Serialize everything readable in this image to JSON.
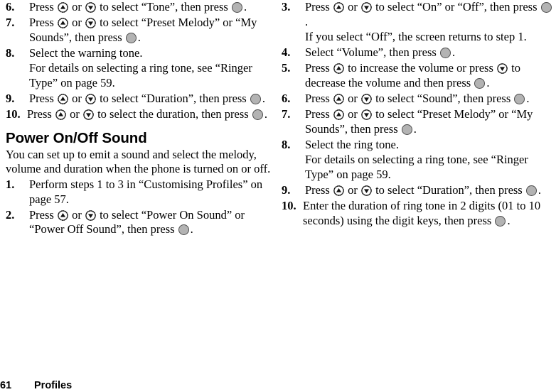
{
  "document": {
    "footer": {
      "page_number": "61",
      "section_title": "Profiles"
    }
  },
  "icons": {
    "up_key": "nav-up-key-icon",
    "down_key": "nav-down-key-icon",
    "select_key": "center-select-key-icon"
  },
  "colors": {
    "text": "#000000",
    "page_background": "#ffffff",
    "select_key_fill": "#b3b3b3",
    "select_key_stroke": "#4d4d4d"
  },
  "left_column": {
    "steps_continued": [
      {
        "number": "6.",
        "parts": [
          {
            "t": "text",
            "v": "Press "
          },
          {
            "t": "key",
            "v": "up"
          },
          {
            "t": "text",
            "v": " or "
          },
          {
            "t": "key",
            "v": "down"
          },
          {
            "t": "text",
            "v": " to select “Tone”, then press "
          },
          {
            "t": "key",
            "v": "select"
          },
          {
            "t": "text",
            "v": "."
          }
        ]
      },
      {
        "number": "7.",
        "parts": [
          {
            "t": "text",
            "v": "Press "
          },
          {
            "t": "key",
            "v": "up"
          },
          {
            "t": "text",
            "v": " or "
          },
          {
            "t": "key",
            "v": "down"
          },
          {
            "t": "text",
            "v": " to select “Preset Melody” or “My Sounds”, then press "
          },
          {
            "t": "key",
            "v": "select"
          },
          {
            "t": "text",
            "v": "."
          }
        ]
      },
      {
        "number": "8.",
        "parts": [
          {
            "t": "text",
            "v": "Select the warning tone."
          }
        ],
        "continuation": [
          {
            "t": "text",
            "v": "For details on selecting a ring tone, see “Ringer Type” on page 59."
          }
        ]
      },
      {
        "number": "9.",
        "parts": [
          {
            "t": "text",
            "v": "Press "
          },
          {
            "t": "key",
            "v": "up"
          },
          {
            "t": "text",
            "v": " or "
          },
          {
            "t": "key",
            "v": "down"
          },
          {
            "t": "text",
            "v": " to select “Duration”, then press "
          },
          {
            "t": "key",
            "v": "select"
          },
          {
            "t": "text",
            "v": "."
          }
        ]
      },
      {
        "number": "10.",
        "wide": true,
        "parts": [
          {
            "t": "text",
            "v": "Press "
          },
          {
            "t": "key",
            "v": "up"
          },
          {
            "t": "text",
            "v": " or "
          },
          {
            "t": "key",
            "v": "down"
          },
          {
            "t": "text",
            "v": " to select the duration, then press "
          },
          {
            "t": "key",
            "v": "select"
          },
          {
            "t": "text",
            "v": "."
          }
        ]
      }
    ],
    "section": {
      "heading": "Power On/Off Sound",
      "intro": "You can set up to emit a sound and select the melody, volume and duration when the phone is turned on or off.",
      "steps": [
        {
          "number": "1.",
          "parts": [
            {
              "t": "text",
              "v": "Perform steps 1 to 3 in “Customising Profiles” on page 57."
            }
          ]
        },
        {
          "number": "2.",
          "parts": [
            {
              "t": "text",
              "v": "Press "
            },
            {
              "t": "key",
              "v": "up"
            },
            {
              "t": "text",
              "v": " or "
            },
            {
              "t": "key",
              "v": "down"
            },
            {
              "t": "text",
              "v": " to select “Power On Sound” or “Power Off Sound”, then press "
            },
            {
              "t": "key",
              "v": "select"
            },
            {
              "t": "text",
              "v": "."
            }
          ]
        }
      ]
    }
  },
  "right_column": {
    "steps": [
      {
        "number": "3.",
        "parts": [
          {
            "t": "text",
            "v": "Press "
          },
          {
            "t": "key",
            "v": "up"
          },
          {
            "t": "text",
            "v": " or "
          },
          {
            "t": "key",
            "v": "down"
          },
          {
            "t": "text",
            "v": " to select “On” or “Off”, then press "
          },
          {
            "t": "key",
            "v": "select"
          },
          {
            "t": "text",
            "v": "."
          }
        ],
        "continuation": [
          {
            "t": "text",
            "v": "If you select “Off”, the screen returns to step 1."
          }
        ]
      },
      {
        "number": "4.",
        "parts": [
          {
            "t": "text",
            "v": "Select “Volume”, then press "
          },
          {
            "t": "key",
            "v": "select"
          },
          {
            "t": "text",
            "v": "."
          }
        ]
      },
      {
        "number": "5.",
        "parts": [
          {
            "t": "text",
            "v": "Press "
          },
          {
            "t": "key",
            "v": "up"
          },
          {
            "t": "text",
            "v": " to increase the volume or press "
          },
          {
            "t": "key",
            "v": "down"
          },
          {
            "t": "text",
            "v": " to decrease the volume and then press "
          },
          {
            "t": "key",
            "v": "select"
          },
          {
            "t": "text",
            "v": "."
          }
        ]
      },
      {
        "number": "6.",
        "parts": [
          {
            "t": "text",
            "v": "Press "
          },
          {
            "t": "key",
            "v": "up"
          },
          {
            "t": "text",
            "v": " or "
          },
          {
            "t": "key",
            "v": "down"
          },
          {
            "t": "text",
            "v": " to select “Sound”, then press "
          },
          {
            "t": "key",
            "v": "select"
          },
          {
            "t": "text",
            "v": "."
          }
        ]
      },
      {
        "number": "7.",
        "parts": [
          {
            "t": "text",
            "v": "Press "
          },
          {
            "t": "key",
            "v": "up"
          },
          {
            "t": "text",
            "v": " or "
          },
          {
            "t": "key",
            "v": "down"
          },
          {
            "t": "text",
            "v": " to select “Preset Melody” or “My Sounds”, then press "
          },
          {
            "t": "key",
            "v": "select"
          },
          {
            "t": "text",
            "v": "."
          }
        ]
      },
      {
        "number": "8.",
        "parts": [
          {
            "t": "text",
            "v": "Select the ring tone."
          }
        ],
        "continuation": [
          {
            "t": "text",
            "v": "For details on selecting a ring tone, see “Ringer Type” on page 59."
          }
        ]
      },
      {
        "number": "9.",
        "parts": [
          {
            "t": "text",
            "v": "Press "
          },
          {
            "t": "key",
            "v": "up"
          },
          {
            "t": "text",
            "v": " or "
          },
          {
            "t": "key",
            "v": "down"
          },
          {
            "t": "text",
            "v": " to select “Duration”, then press "
          },
          {
            "t": "key",
            "v": "select"
          },
          {
            "t": "text",
            "v": "."
          }
        ]
      },
      {
        "number": "10.",
        "wide": true,
        "parts": [
          {
            "t": "text",
            "v": "Enter the duration of ring tone in 2 digits (01 to 10 seconds) using the digit keys, then press "
          },
          {
            "t": "key",
            "v": "select"
          },
          {
            "t": "text",
            "v": "."
          }
        ]
      }
    ]
  }
}
